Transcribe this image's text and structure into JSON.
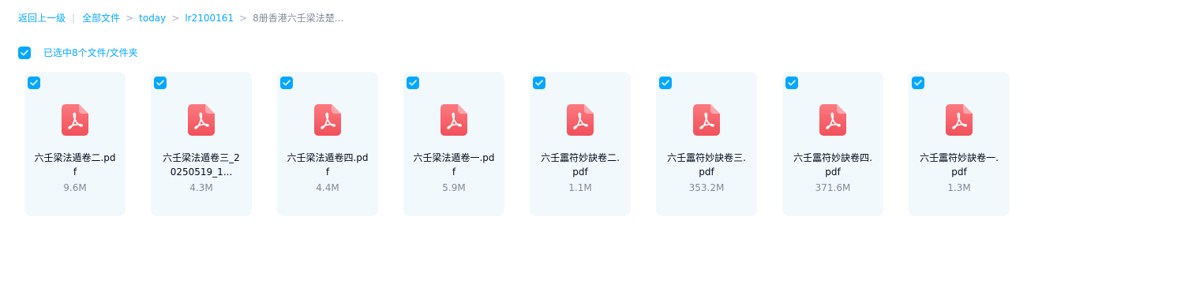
{
  "breadcrumb": {
    "back": "返回上一级",
    "divider": "|",
    "items": [
      "全部文件",
      "today",
      "lr2100161"
    ],
    "current": "8册香港六壬梁法楚...",
    "separator": ">"
  },
  "selection": {
    "label": "已选中8个文件/文件夹",
    "checked": true
  },
  "colors": {
    "accent": "#06a7ff",
    "card_bg": "#f2f9fd",
    "pdf_icon": "#f55f68"
  },
  "files": [
    {
      "name_line1": "六壬梁法遁卷二.pd",
      "name_line2": "f",
      "size": "9.6M",
      "icon": "pdf-icon",
      "selected": true
    },
    {
      "name_line1": "六壬梁法遁卷三_2",
      "name_line2": "0250519_1...",
      "size": "4.3M",
      "icon": "pdf-icon",
      "selected": true
    },
    {
      "name_line1": "六壬梁法遁卷四.pd",
      "name_line2": "f",
      "size": "4.4M",
      "icon": "pdf-icon",
      "selected": true
    },
    {
      "name_line1": "六壬梁法遁卷一.pd",
      "name_line2": "f",
      "size": "5.9M",
      "icon": "pdf-icon",
      "selected": true
    },
    {
      "name_line1": "六壬靁符妙訣卷二.",
      "name_line2": "pdf",
      "size": "1.1M",
      "icon": "pdf-icon",
      "selected": true
    },
    {
      "name_line1": "六壬靁符妙訣卷三.",
      "name_line2": "pdf",
      "size": "353.2M",
      "icon": "pdf-icon",
      "selected": true
    },
    {
      "name_line1": "六壬靁符妙訣卷四.",
      "name_line2": "pdf",
      "size": "371.6M",
      "icon": "pdf-icon",
      "selected": true
    },
    {
      "name_line1": "六壬靁符妙訣卷一.",
      "name_line2": "pdf",
      "size": "1.3M",
      "icon": "pdf-icon",
      "selected": true
    }
  ]
}
